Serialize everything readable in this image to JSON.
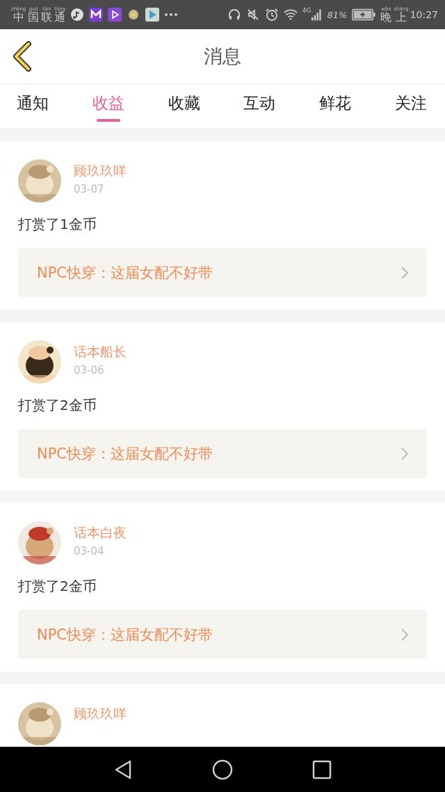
{
  "status_bar": {
    "carrier": [
      {
        "char": "中",
        "pinyin": "zhōng"
      },
      {
        "char": "国",
        "pinyin": "guó"
      },
      {
        "char": "联",
        "pinyin": "lián"
      },
      {
        "char": "通",
        "pinyin": "tōng"
      }
    ],
    "network": "4G",
    "battery_percent": "81%",
    "time_prefix": [
      {
        "char": "晚",
        "pinyin": "wǎn"
      },
      {
        "char": "上",
        "pinyin": "shàng"
      }
    ],
    "time": "10:27"
  },
  "header": {
    "title": "消息"
  },
  "tabs": [
    {
      "label": "通知",
      "selected": false
    },
    {
      "label": "收益",
      "selected": true
    },
    {
      "label": "收藏",
      "selected": false
    },
    {
      "label": "互动",
      "selected": false
    },
    {
      "label": "鲜花",
      "selected": false
    },
    {
      "label": "关注",
      "selected": false
    }
  ],
  "messages": [
    {
      "user": "顾玖玖咩",
      "date": "03-07",
      "text": "打赏了1金币",
      "book": "NPC快穿：这届女配不好带"
    },
    {
      "user": "话本船长",
      "date": "03-06",
      "text": "打赏了2金币",
      "book": "NPC快穿：这届女配不好带"
    },
    {
      "user": "话本白夜",
      "date": "03-04",
      "text": "打赏了2金币",
      "book": "NPC快穿：这届女配不好带"
    },
    {
      "user": "顾玖玖咩"
    }
  ]
}
